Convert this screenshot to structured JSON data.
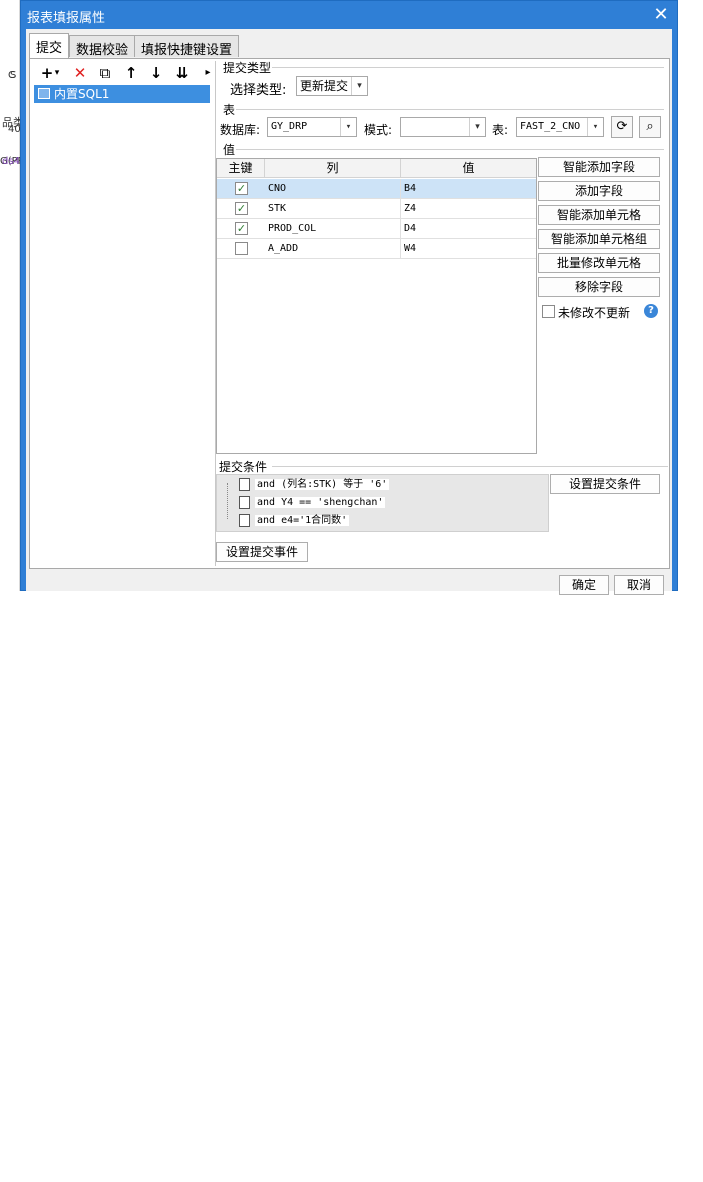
{
  "window": {
    "title": "报表填报属性",
    "close_glyph": "✕"
  },
  "background": {
    "col_c": "C",
    "col_s": "S",
    "cell_left1": "品类",
    "cell_left2": "G(PRO",
    "cell_right1": "40",
    "cell_right2": "ds4."
  },
  "tabs": [
    {
      "label": "提交",
      "active": true
    },
    {
      "label": "数据校验",
      "active": false
    },
    {
      "label": "填报快捷键设置",
      "active": false
    }
  ],
  "toolbar": {
    "add_icon": "+",
    "add_drop": "▾",
    "delete_icon": "✕",
    "copy_icon": "⧉",
    "up_icon": "↑",
    "down_icon": "↓",
    "order_icon": "⇊",
    "more_icon": "▸"
  },
  "tree": {
    "items": [
      {
        "label": "内置SQL1"
      }
    ]
  },
  "submit_type": {
    "group_label": "提交类型",
    "select_label": "选择类型:",
    "select_value": "更新提交"
  },
  "table_group": {
    "group_label": "表",
    "db_label": "数据库:",
    "db_value": "GY_DRP",
    "mode_label": "模式:",
    "mode_value": "",
    "table_label": "表:",
    "table_value": "FAST_2_CNO",
    "refresh_icon": "⟳",
    "preview_icon": "⌕"
  },
  "values": {
    "group_label": "值",
    "columns": [
      "主键",
      "列",
      "值"
    ],
    "rows": [
      {
        "key": true,
        "column": "CNO",
        "value": "B4",
        "selected": true
      },
      {
        "key": true,
        "column": "STK",
        "value": "Z4",
        "selected": false
      },
      {
        "key": true,
        "column": "PROD_COL",
        "value": "D4",
        "selected": false
      },
      {
        "key": false,
        "column": "A_ADD",
        "value": "W4",
        "selected": false
      }
    ],
    "check_mark": "✓",
    "buttons": [
      "智能添加字段",
      "添加字段",
      "智能添加单元格",
      "智能添加单元格组",
      "批量修改单元格",
      "移除字段"
    ],
    "no_update_label": "未修改不更新",
    "help_icon": "?"
  },
  "conditions": {
    "group_label": "提交条件",
    "items": [
      "and (列名:STK) 等于 '6'",
      "and Y4 == 'shengchan'",
      "and e4='1合同数'"
    ],
    "set_button": "设置提交条件"
  },
  "event_button": "设置提交事件",
  "footer": {
    "ok": "确定",
    "cancel": "取消"
  }
}
